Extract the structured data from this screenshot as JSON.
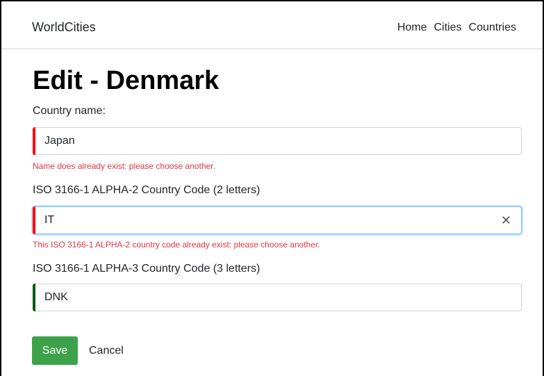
{
  "navbar": {
    "brand": "WorldCities",
    "links": [
      "Home",
      "Cities",
      "Countries"
    ]
  },
  "page": {
    "title": "Edit - Denmark"
  },
  "form": {
    "name": {
      "label": "Country name:",
      "value": "Japan",
      "state": "invalid",
      "error": "Name does already exist: please choose another."
    },
    "iso2": {
      "label": "ISO 3166-1 ALPHA-2 Country Code (2 letters)",
      "value": "IT",
      "state": "invalid",
      "error": "This ISO 3166-1 ALPHA-2 country code already exist: please choose another."
    },
    "iso3": {
      "label": "ISO 3166-1 ALPHA-3 Country Code (3 letters)",
      "value": "DNK",
      "state": "valid"
    },
    "save_label": "Save",
    "cancel_label": "Cancel"
  },
  "colors": {
    "invalid": "#ff0000",
    "valid": "#0a5b14",
    "error_text": "#dc3545",
    "save_button": "#3da24a"
  },
  "icons": {
    "clear": "close-icon"
  }
}
